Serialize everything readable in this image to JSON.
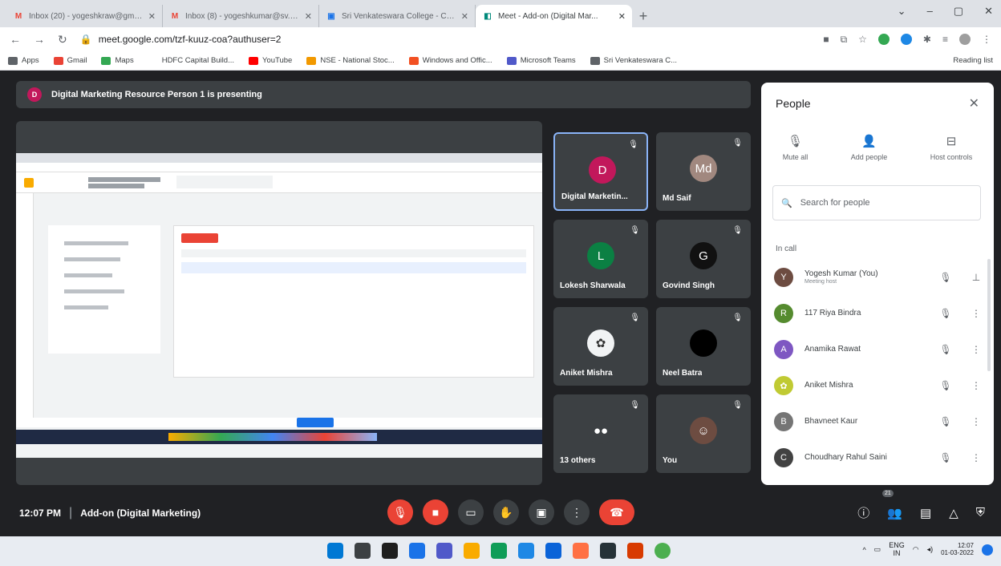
{
  "browser": {
    "tabs": [
      {
        "title": "Inbox (20) - yogeshkraw@gmail...",
        "icon": "gmail-icon",
        "icon_glyph": "M",
        "icon_color": "#ea4335",
        "active": false
      },
      {
        "title": "Inbox (8) - yogeshkumar@sv.c...",
        "icon": "gmail-icon",
        "icon_glyph": "M",
        "icon_color": "#ea4335",
        "active": false
      },
      {
        "title": "Sri Venkateswara College - Cale...",
        "icon": "calendar-icon",
        "icon_glyph": "▣",
        "icon_color": "#1a73e8",
        "active": false
      },
      {
        "title": "Meet - Add-on (Digital Mar...",
        "icon": "meet-icon",
        "icon_glyph": "◧",
        "icon_color": "#00897b",
        "active": true
      }
    ],
    "new_tab_glyph": "+",
    "window_controls": [
      "⌄",
      "–",
      "▢",
      "✕"
    ],
    "url": "meet.google.com/tzf-kuuz-coa?authuser=2",
    "bookmarks": [
      {
        "label": "Apps",
        "color": "#5f6368"
      },
      {
        "label": "Gmail",
        "color": "#ea4335"
      },
      {
        "label": "Maps",
        "color": "#34a853"
      },
      {
        "label": "HDFC Capital Build...",
        "color": "#ffffff"
      },
      {
        "label": "YouTube",
        "color": "#ff0000"
      },
      {
        "label": "NSE - National Stoc...",
        "color": "#f29900"
      },
      {
        "label": "Windows and Offic...",
        "color": "#f25022"
      },
      {
        "label": "Microsoft Teams",
        "color": "#5059c9"
      },
      {
        "label": "Sri Venkateswara C...",
        "color": "#5f6368"
      }
    ],
    "reading_list": "Reading list"
  },
  "meet": {
    "presenting_avatar": "D",
    "presenting_text": "Digital Marketing Resource Person 1 is presenting",
    "tiles": [
      {
        "name": "Digital Marketin...",
        "avatar": "D",
        "avatar_color": "#c2185b",
        "highlight": true
      },
      {
        "name": "Md Saif",
        "avatar": "Md",
        "avatar_color": "#a1887f",
        "highlight": false
      },
      {
        "name": "Lokesh Sharwala",
        "avatar": "L",
        "avatar_color": "#0b8043",
        "highlight": false
      },
      {
        "name": "Govind Singh",
        "avatar": "G",
        "avatar_color": "#111111",
        "highlight": false
      },
      {
        "name": "Aniket Mishra",
        "avatar": "✿",
        "avatar_color": "#f1f3f4",
        "highlight": false
      },
      {
        "name": "Neel Batra",
        "avatar": "",
        "avatar_color": "#000000",
        "highlight": false
      },
      {
        "name": "13 others",
        "avatar": "●●",
        "avatar_color": "#3c4043",
        "highlight": false
      },
      {
        "name": "You",
        "avatar": "☺",
        "avatar_color": "#6d4c41",
        "highlight": false
      }
    ],
    "people_panel": {
      "title": "People",
      "actions": [
        {
          "label": "Mute all",
          "icon": "mic-off-icon",
          "glyph": "🎙"
        },
        {
          "label": "Add people",
          "icon": "add-person-icon",
          "glyph": "👤"
        },
        {
          "label": "Host controls",
          "icon": "host-controls-icon",
          "glyph": "⊟"
        }
      ],
      "search_placeholder": "Search for people",
      "section_label": "In call",
      "participants": [
        {
          "name": "Yogesh Kumar (You)",
          "sub": "Meeting host",
          "avatar": "Y",
          "color": "#6d4c41"
        },
        {
          "name": "117 Riya Bindra",
          "sub": "",
          "avatar": "R",
          "color": "#558b2f"
        },
        {
          "name": "Anamika Rawat",
          "sub": "",
          "avatar": "A",
          "color": "#7e57c2"
        },
        {
          "name": "Aniket Mishra",
          "sub": "",
          "avatar": "✿",
          "color": "#c0ca33"
        },
        {
          "name": "Bhavneet Kaur",
          "sub": "",
          "avatar": "B",
          "color": "#757575"
        },
        {
          "name": "Choudhary Rahul Saini",
          "sub": "",
          "avatar": "C",
          "color": "#424242"
        }
      ]
    },
    "bottom": {
      "time": "12:07 PM",
      "separator": "|",
      "title": "Add-on (Digital Marketing)",
      "participant_count": "21"
    }
  },
  "taskbar": {
    "lang_top": "ENG",
    "lang_bottom": "IN",
    "time": "12:07",
    "date": "01-03-2022"
  }
}
